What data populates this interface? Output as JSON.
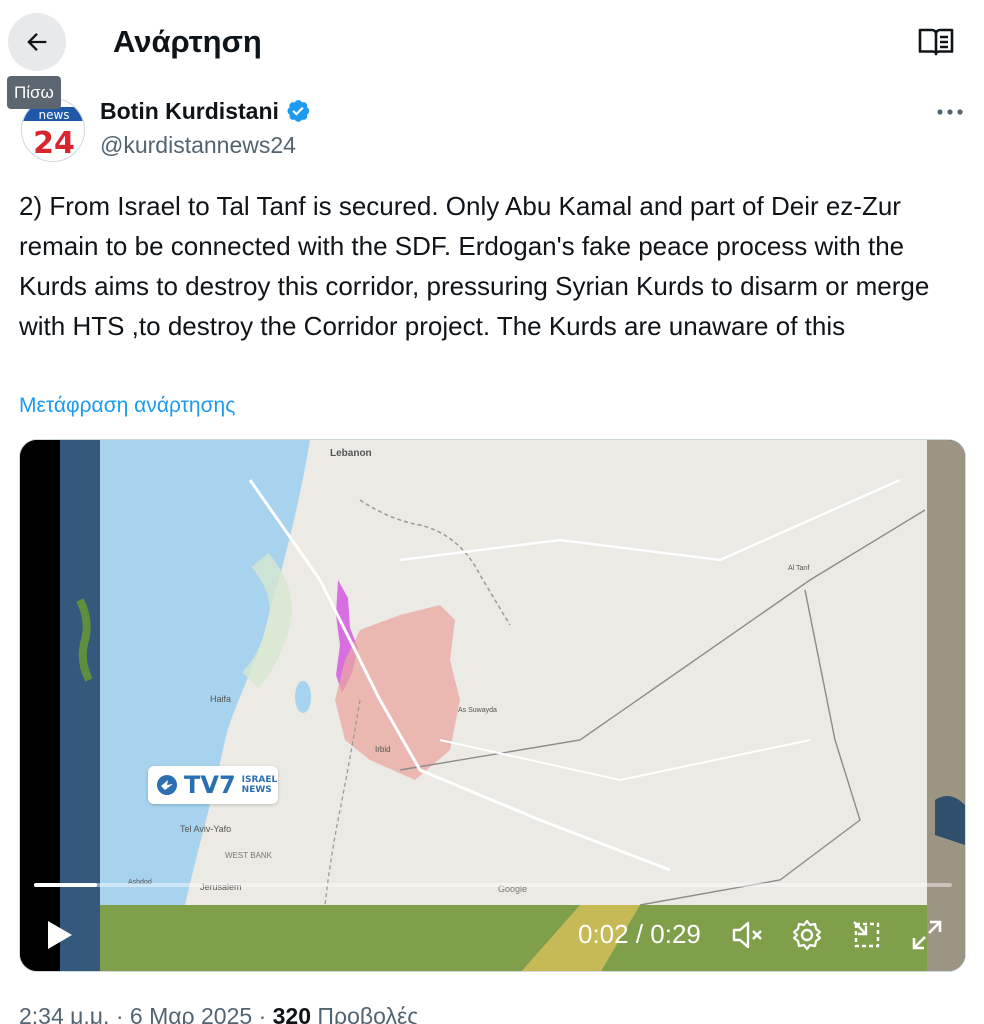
{
  "header": {
    "title": "Ανάρτηση",
    "back_tooltip": "Πίσω"
  },
  "author": {
    "name": "Botin Kurdistani",
    "handle": "@kurdistannews24",
    "avatar_text": "news",
    "avatar_number": "24"
  },
  "post": {
    "text": "2) From Israel to Tal Tanf is secured. Only Abu Kamal and part of Deir ez-Zur remain to be connected with the SDF. Erdogan's fake peace process with the Kurds aims to destroy this corridor, pressuring Syrian Kurds to disarm or merge with HTS ,to destroy the Corridor project. The Kurds are unaware of this",
    "translate_label": "Μετάφραση ανάρτησης"
  },
  "video": {
    "time_label": "0:02 / 0:29",
    "progress_fraction": 0.069,
    "logo_main": "TV7",
    "logo_sub_1": "ISRAEL",
    "logo_sub_2": "NEWS",
    "map_labels": {
      "lebanon": "Lebanon",
      "haifa": "Haifa",
      "tel_aviv": "Tel Aviv-Yafo",
      "west_bank": "WEST BANK",
      "jerusalem": "Jerusalem",
      "irbid": "Irbid",
      "as_suwayda": "As Suwayda",
      "al_tanf": "Al Tanf",
      "google": "Google",
      "ashdod": "Ashdod"
    }
  },
  "meta": {
    "time": "2:34 μ.μ.",
    "sep": "·",
    "date": "6 Μαρ 2025",
    "views": "320",
    "views_label": "Προβολές"
  },
  "colors": {
    "accent": "#1d9bf0",
    "verified": "#1d9bf0",
    "sea": "#a7d3ee",
    "land": "#eceae4",
    "region_red": "#e9a7a0",
    "region_magenta": "#d660e0"
  },
  "icons": {
    "back": "arrow-left-icon",
    "reader": "reader-mode-icon",
    "verified": "verified-badge-icon",
    "more": "more-icon",
    "play": "play-icon",
    "mute": "volume-muted-icon",
    "settings": "gear-icon",
    "pip": "picture-in-picture-icon",
    "fullscreen": "fullscreen-icon"
  }
}
